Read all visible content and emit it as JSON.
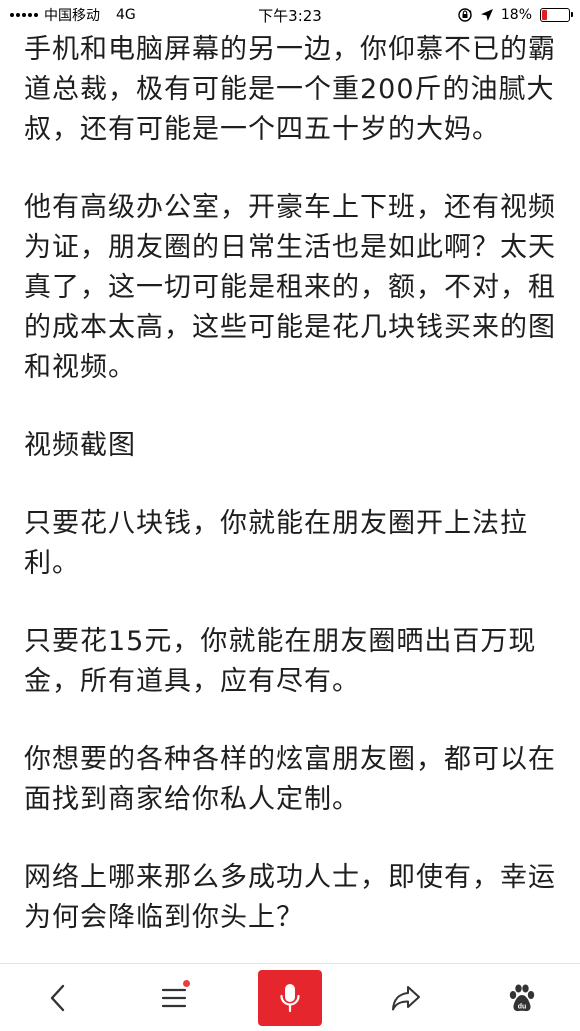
{
  "status_bar": {
    "carrier": "中国移动",
    "network": "4G",
    "time": "下午3:23",
    "battery_percent_label": "18%",
    "battery_level": 0.18,
    "battery_color": "#e02020"
  },
  "article": {
    "paragraphs": [
      "手机和电脑屏幕的另一边，你仰慕不已的霸\n道总裁，极有可能是一个重200斤的油腻大\n叔，还有可能是一个四五十岁的大妈。",
      "他有高级办公室，开豪车上下班，还有视频\n为证，朋友圈的日常生活也是如此啊？太天\n真了，这一切可能是租来的，额，不对，租\n的成本太高，这些可能是花几块钱买来的图\n和视频。",
      "视频截图",
      "只要花八块钱，你就能在朋友圈开上法拉\n利。",
      "只要花15元，你就能在朋友圈晒出百万现\n金，所有道具，应有尽有。",
      "你想要的各种各样的炫富朋友圈，都可以在\n面找到商家给你私人定制。",
      "网络上哪来那么多成功人士，即使有，幸运\n为何会降临到你头上？"
    ]
  },
  "toolbar": {
    "icons": [
      "back-icon",
      "menu-icon",
      "microphone-icon",
      "share-icon",
      "baidu-paw-icon"
    ],
    "accent_color": "#e5262c",
    "notification_dot_color": "#e8403a"
  }
}
